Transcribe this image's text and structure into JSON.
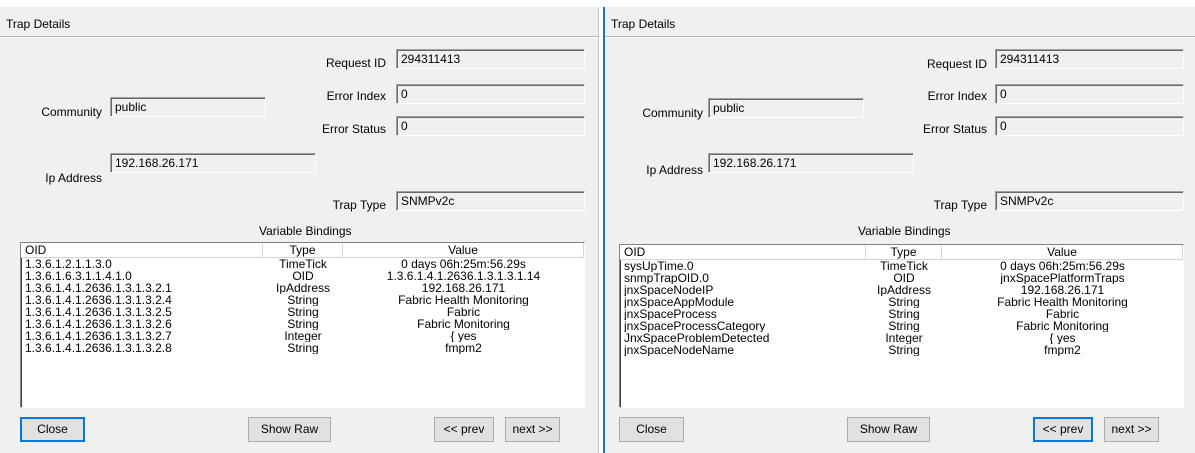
{
  "left": {
    "title": "Trap Details",
    "request_id_label": "Request ID",
    "request_id": "294311413",
    "error_index_label": "Error Index",
    "error_index": "0",
    "error_status_label": "Error Status",
    "error_status": "0",
    "community_label": "Community",
    "community": "public",
    "ip_label": "Ip Address",
    "ip": "192.168.26.171",
    "trap_type_label": "Trap Type",
    "trap_type": "SNMPv2c",
    "bindings_label": "Variable Bindings",
    "columns": {
      "oid": "OID",
      "type": "Type",
      "value": "Value"
    },
    "rows": [
      {
        "oid": "1.3.6.1.2.1.1.3.0",
        "type": "TimeTick",
        "value": "0 days 06h:25m:56.29s"
      },
      {
        "oid": "1.3.6.1.6.3.1.1.4.1.0",
        "type": "OID",
        "value": "1.3.6.1.4.1.2636.1.3.1.3.1.14"
      },
      {
        "oid": "1.3.6.1.4.1.2636.1.3.1.3.2.1",
        "type": "IpAddress",
        "value": "192.168.26.171"
      },
      {
        "oid": "1.3.6.1.4.1.2636.1.3.1.3.2.4",
        "type": "String",
        "value": "Fabric Health Monitoring"
      },
      {
        "oid": "1.3.6.1.4.1.2636.1.3.1.3.2.5",
        "type": "String",
        "value": "Fabric"
      },
      {
        "oid": "1.3.6.1.4.1.2636.1.3.1.3.2.6",
        "type": "String",
        "value": "Fabric Monitoring"
      },
      {
        "oid": "1.3.6.1.4.1.2636.1.3.1.3.2.7",
        "type": "Integer",
        "value": "{ yes"
      },
      {
        "oid": "1.3.6.1.4.1.2636.1.3.1.3.2.8",
        "type": "String",
        "value": "fmpm2"
      }
    ],
    "close_label": "Close",
    "show_raw_label": "Show Raw",
    "prev_label": "<< prev",
    "next_label": "next >>"
  },
  "right": {
    "title": "Trap Details",
    "request_id_label": "Request ID",
    "request_id": "294311413",
    "error_index_label": "Error Index",
    "error_index": "0",
    "error_status_label": "Error Status",
    "error_status": "0",
    "community_label": "Community",
    "community": "public",
    "ip_label": "Ip Address",
    "ip": "192.168.26.171",
    "trap_type_label": "Trap Type",
    "trap_type": "SNMPv2c",
    "bindings_label": "Variable Bindings",
    "columns": {
      "oid": "OID",
      "type": "Type",
      "value": "Value"
    },
    "rows": [
      {
        "oid": "sysUpTime.0",
        "type": "TimeTick",
        "value": "0 days 06h:25m:56.29s"
      },
      {
        "oid": "snmpTrapOID.0",
        "type": "OID",
        "value": "jnxSpacePlatformTraps"
      },
      {
        "oid": "jnxSpaceNodeIP",
        "type": "IpAddress",
        "value": "192.168.26.171"
      },
      {
        "oid": "jnxSpaceAppModule",
        "type": "String",
        "value": "Fabric Health Monitoring"
      },
      {
        "oid": "jnxSpaceProcess",
        "type": "String",
        "value": "Fabric"
      },
      {
        "oid": "jnxSpaceProcessCategory",
        "type": "String",
        "value": "Fabric Monitoring"
      },
      {
        "oid": "JnxSpaceProblemDetected",
        "type": "Integer",
        "value": "{ yes"
      },
      {
        "oid": "jnxSpaceNodeName",
        "type": "String",
        "value": "fmpm2"
      }
    ],
    "close_label": "Close",
    "show_raw_label": "Show Raw",
    "prev_label": "<< prev",
    "next_label": "next >>"
  }
}
